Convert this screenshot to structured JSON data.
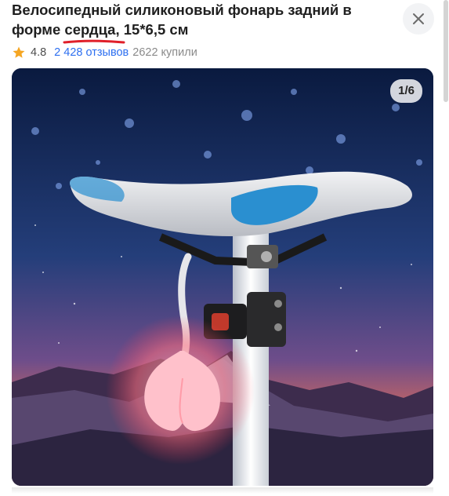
{
  "product": {
    "title_before": "Велосипедный силиконовый фонарь задний в форме ",
    "title_highlight": "сердца",
    "title_after": ", 15*6,5 см"
  },
  "rating": {
    "value": "4.8",
    "reviews": "2 428 отзывов",
    "purchases": "2622 купили"
  },
  "gallery": {
    "counter": "1/6"
  },
  "colors": {
    "star": "#f5a623",
    "link": "#2d6ff0",
    "highlight_underline": "#e0202a"
  },
  "icons": {
    "close": "close-icon",
    "star": "star-icon"
  }
}
